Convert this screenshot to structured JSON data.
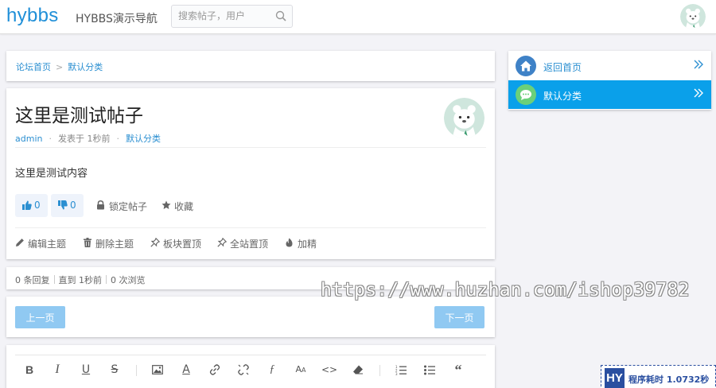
{
  "header": {
    "logo": "hybbs",
    "site_nav": "HYBBS演示导航",
    "search_placeholder": "搜索帖子，用户"
  },
  "breadcrumb": {
    "home": "论坛首页",
    "separator": ">",
    "category": "默认分类"
  },
  "post": {
    "title": "这里是测试帖子",
    "author": "admin",
    "posted_at": "发表于 1秒前",
    "category": "默认分类",
    "content": "这里是测试内容",
    "likes": "0",
    "dislikes": "0",
    "lock_label": "锁定帖子",
    "favorite_label": "收藏",
    "edit_label": "编辑主题",
    "delete_label": "删除主题",
    "pin_board_label": "板块置顶",
    "pin_site_label": "全站置顶",
    "feature_label": "加精"
  },
  "stats": {
    "replies": "0 条回复",
    "last": "直到 1秒前",
    "views": "0 次浏览"
  },
  "pager": {
    "prev": "上一页",
    "next": "下一页"
  },
  "sidebar": {
    "items": [
      {
        "label": "返回首页",
        "icon": "home-icon"
      },
      {
        "label": "默认分类",
        "icon": "chat-bubble-icon"
      }
    ]
  },
  "watermark": "https://www.huzhan.com/ishop39782",
  "timer": {
    "badge": "HY",
    "label": "程序耗时 1.0732秒"
  },
  "colors": {
    "brand": "#1f8fd8",
    "link": "#2b8fd1",
    "sidebar_active": "#0aa0ea",
    "button": "#90c9f2"
  }
}
